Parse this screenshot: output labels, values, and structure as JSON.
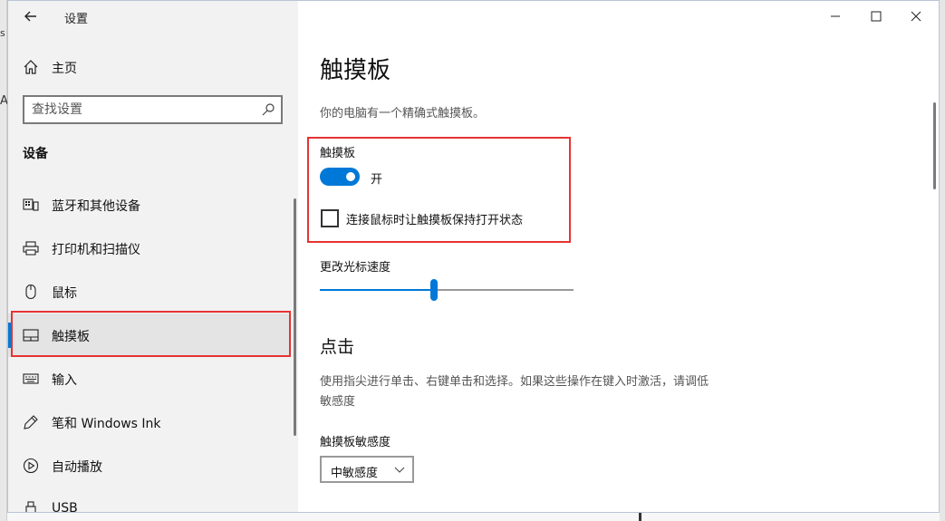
{
  "window": {
    "title": "设置"
  },
  "background": {
    "left_fragments": [
      "s",
      "A"
    ]
  },
  "sidebar": {
    "home_label": "主页",
    "search_placeholder": "查找设置",
    "section_title": "设备",
    "items": [
      {
        "label": "蓝牙和其他设备",
        "icon": "bluetooth-devices-icon"
      },
      {
        "label": "打印机和扫描仪",
        "icon": "printer-icon"
      },
      {
        "label": "鼠标",
        "icon": "mouse-icon"
      },
      {
        "label": "触摸板",
        "icon": "touchpad-icon",
        "selected": true
      },
      {
        "label": "输入",
        "icon": "keyboard-icon"
      },
      {
        "label": "笔和 Windows Ink",
        "icon": "pen-icon"
      },
      {
        "label": "自动播放",
        "icon": "autoplay-icon"
      },
      {
        "label": "USB",
        "icon": "usb-icon"
      }
    ]
  },
  "content": {
    "title": "触摸板",
    "description": "你的电脑有一个精确式触摸板。",
    "touchpad_section": {
      "label": "触摸板",
      "toggle_on": true,
      "toggle_state_text": "开",
      "keep_on_with_mouse_label": "连接鼠标时让触摸板保持打开状态",
      "keep_on_with_mouse_checked": false
    },
    "cursor_speed": {
      "label": "更改光标速度",
      "value_fraction": 0.45
    },
    "click_section": {
      "title": "点击",
      "description": "使用指尖进行单击、右键单击和选择。如果这些操作在键入时激活，请调低敏感度"
    },
    "sensitivity": {
      "label": "触摸板敏感度",
      "selected": "中敏感度"
    }
  },
  "colors": {
    "accent": "#0078d7",
    "highlight_red": "#e53333",
    "sidebar_bg": "#f2f2f2"
  }
}
